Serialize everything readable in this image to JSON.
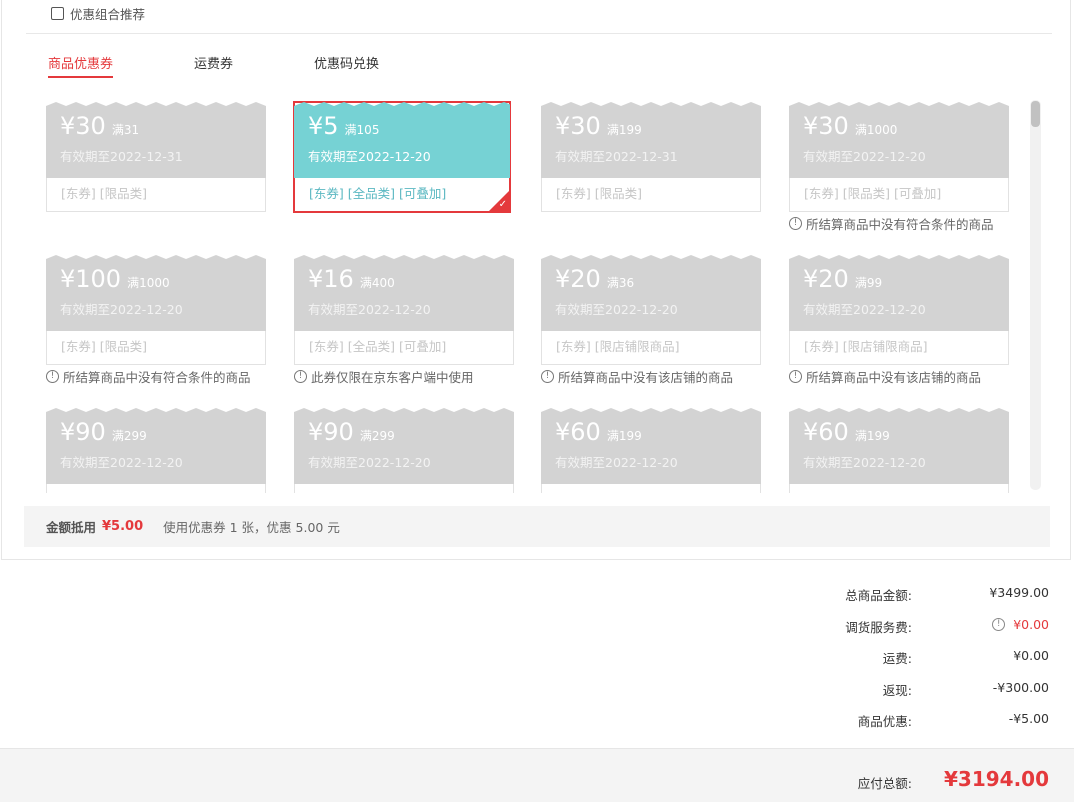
{
  "combo": {
    "label": "优惠组合推荐"
  },
  "tabs": [
    {
      "label": "商品优惠券",
      "active": true
    },
    {
      "label": "运费券",
      "active": false
    },
    {
      "label": "优惠码兑换",
      "active": false
    }
  ],
  "coupons": [
    {
      "price": "¥30",
      "cond": "满31",
      "valid": "有效期至2022-12-31",
      "tags": "[东券]  [限品类]",
      "note": ""
    },
    {
      "price": "¥5",
      "cond": "满105",
      "valid": "有效期至2022-12-20",
      "tags": "[东券]  [全品类]  [可叠加]",
      "note": "",
      "selected": true
    },
    {
      "price": "¥30",
      "cond": "满199",
      "valid": "有效期至2022-12-31",
      "tags": "[东券]  [限品类]",
      "note": ""
    },
    {
      "price": "¥30",
      "cond": "满1000",
      "valid": "有效期至2022-12-20",
      "tags": "[东券]  [限品类]  [可叠加]",
      "note": "所结算商品中没有符合条件的商品"
    },
    {
      "price": "¥100",
      "cond": "满1000",
      "valid": "有效期至2022-12-20",
      "tags": "[东券]  [限品类]",
      "note": "所结算商品中没有符合条件的商品"
    },
    {
      "price": "¥16",
      "cond": "满400",
      "valid": "有效期至2022-12-20",
      "tags": "[东券]  [全品类]  [可叠加]",
      "note": "此券仅限在京东客户端中使用"
    },
    {
      "price": "¥20",
      "cond": "满36",
      "valid": "有效期至2022-12-20",
      "tags": "[东券]  [限店铺限商品]",
      "note": "所结算商品中没有该店铺的商品"
    },
    {
      "price": "¥20",
      "cond": "满99",
      "valid": "有效期至2022-12-20",
      "tags": "[东券]  [限店铺限商品]",
      "note": "所结算商品中没有该店铺的商品"
    },
    {
      "price": "¥90",
      "cond": "满299",
      "valid": "有效期至2022-12-20",
      "tags": "",
      "note": ""
    },
    {
      "price": "¥90",
      "cond": "满299",
      "valid": "有效期至2022-12-20",
      "tags": "",
      "note": ""
    },
    {
      "price": "¥60",
      "cond": "满199",
      "valid": "有效期至2022-12-20",
      "tags": "",
      "note": ""
    },
    {
      "price": "¥60",
      "cond": "满199",
      "valid": "有效期至2022-12-20",
      "tags": "",
      "note": ""
    }
  ],
  "summary": {
    "label": "金额抵用",
    "amount": "¥5.00",
    "desc": "使用优惠券 1 张，优惠 5.00 元"
  },
  "totals": [
    {
      "label": "总商品金额:",
      "value": "¥3499.00"
    },
    {
      "label": "调货服务费:",
      "value": "¥0.00",
      "info": true,
      "red": true
    },
    {
      "label": "运费:",
      "value": "¥0.00"
    },
    {
      "label": "返现:",
      "value": "-¥300.00"
    },
    {
      "label": "商品优惠:",
      "value": "-¥5.00"
    }
  ],
  "pay": {
    "label": "应付总额:",
    "value": "¥3194.00"
  },
  "colors": {
    "accent": "#e4393c",
    "selected_coupon": "#76d2d4",
    "disabled_coupon": "#d3d3d3"
  }
}
